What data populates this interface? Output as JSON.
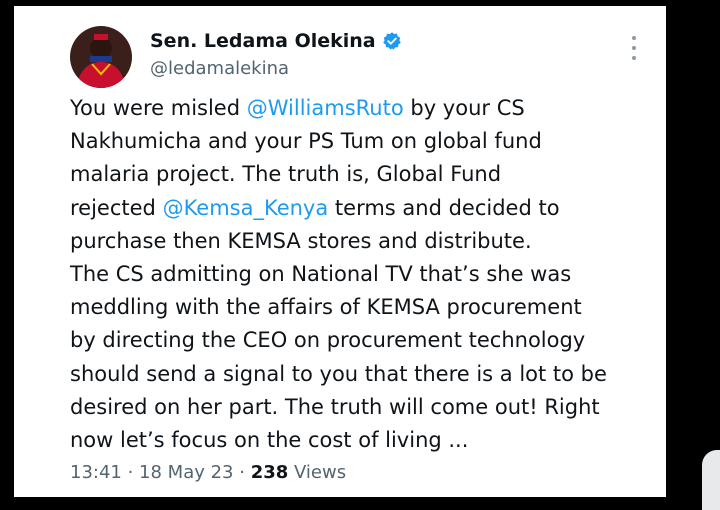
{
  "tweet": {
    "author": {
      "display_name": "Sen. Ledama Olekina",
      "handle": "@ledamalekina",
      "verified_icon": "verified-badge-icon",
      "badge_color": "#1d9bf0"
    },
    "body_lines": [
      [
        {
          "text": "You were misled "
        },
        {
          "text": "@WilliamsRuto",
          "mention": true
        },
        {
          "text": " by your CS"
        }
      ],
      [
        {
          "text": "Nakhumicha and your PS Tum on global fund"
        }
      ],
      [
        {
          "text": "malaria project. The truth is, Global Fund"
        }
      ],
      [
        {
          "text": "rejected "
        },
        {
          "text": "@Kemsa_Kenya",
          "mention": true
        },
        {
          "text": " terms and decided to"
        }
      ],
      [
        {
          "text": "purchase then KEMSA stores and distribute."
        }
      ],
      [
        {
          "text": "The CS admitting on National TV that’s she was"
        }
      ],
      [
        {
          "text": "meddling with the affairs of KEMSA procurement"
        }
      ],
      [
        {
          "text": "by directing the CEO on procurement technology"
        }
      ],
      [
        {
          "text": "should send a signal to you that there is a lot to be"
        }
      ],
      [
        {
          "text": "desired on her part. The truth will come out! Right"
        }
      ],
      [
        {
          "text": "now let’s focus on the cost of living ..."
        }
      ]
    ],
    "meta": {
      "time": "13:41",
      "separator": " · ",
      "date": "18 May 23",
      "views_count": "238",
      "views_label": " Views"
    },
    "more_icon": "more-options-icon"
  },
  "colors": {
    "mention": "#1d9bf0",
    "text": "#0f1419",
    "secondary": "#536471",
    "background": "#000000",
    "card": "#ffffff"
  }
}
